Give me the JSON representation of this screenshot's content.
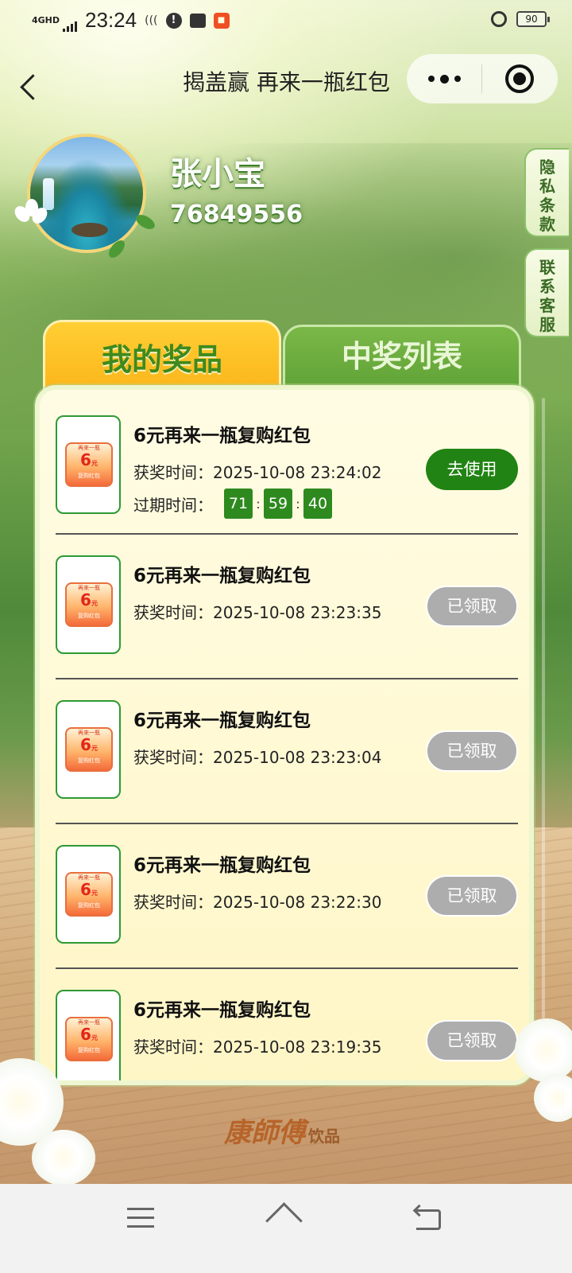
{
  "status_bar": {
    "network": "4GHD",
    "time": "23:24",
    "icons": [
      "signal-icon",
      "wifi-call-icon",
      "alert-icon",
      "mail-icon",
      "app-icon",
      "alarm-icon",
      "battery-icon"
    ],
    "battery": "90"
  },
  "nav": {
    "title": "揭盖赢 再来一瓶红包",
    "back_icon": "chevron-left-icon",
    "more_icon": "more-dots-icon",
    "close_icon": "target-close-icon"
  },
  "profile": {
    "name": "张小宝",
    "user_id": "76849556"
  },
  "side_tabs": {
    "privacy": [
      "隐",
      "私",
      "条",
      "款"
    ],
    "contact": [
      "联",
      "系",
      "客",
      "服"
    ]
  },
  "tabs": {
    "mine": "我的奖品",
    "winners": "中奖列表"
  },
  "prize_labels": {
    "time_label": "获奖时间：",
    "expiry_label": "过期时间："
  },
  "coupon_art": {
    "top": "再来一瓶",
    "amount": "6",
    "unit": "元",
    "bottom": "复购红包"
  },
  "prizes": [
    {
      "title": "6元再来一瓶复购红包",
      "time": "2025-10-08 23:24:02",
      "countdown": [
        "71",
        "59",
        "40"
      ],
      "action": "去使用",
      "action_state": "active"
    },
    {
      "title": "6元再来一瓶复购红包",
      "time": "2025-10-08 23:23:35",
      "action": "已领取",
      "action_state": "claimed"
    },
    {
      "title": "6元再来一瓶复购红包",
      "time": "2025-10-08 23:23:04",
      "action": "已领取",
      "action_state": "claimed"
    },
    {
      "title": "6元再来一瓶复购红包",
      "time": "2025-10-08 23:22:30",
      "action": "已领取",
      "action_state": "claimed"
    },
    {
      "title": "6元再来一瓶复购红包",
      "time": "2025-10-08 23:19:35",
      "action": "已领取",
      "action_state": "claimed"
    }
  ],
  "brand": {
    "main": "康師傅",
    "sub": "饮品"
  },
  "colors": {
    "use_button": "#218313",
    "claimed_button": "#adadad",
    "active_tab": "#fbb319",
    "inactive_tab": "#5c9f34",
    "countdown_box": "#2e8a1f"
  }
}
